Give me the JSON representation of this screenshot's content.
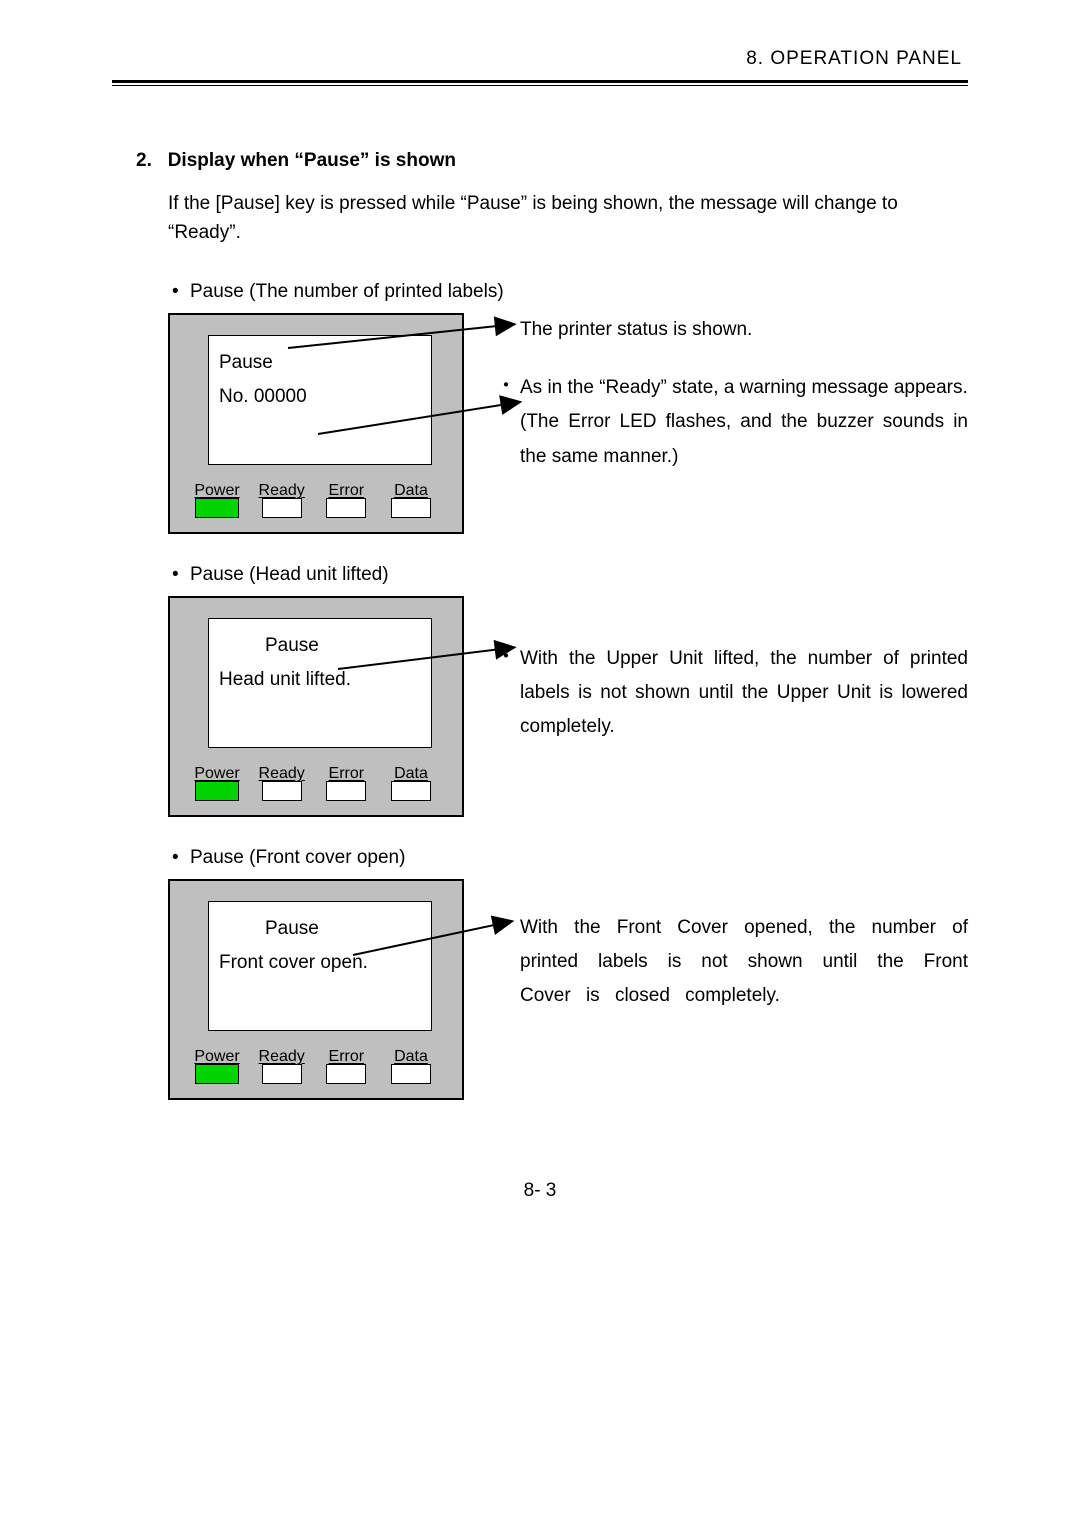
{
  "header": {
    "chapter": "8.  OPERATION  PANEL"
  },
  "section": {
    "num": "2.",
    "title": "Display when “Pause” is shown",
    "lead": "If the [Pause] key is pressed while “Pause” is being shown, the message will change to “Ready”."
  },
  "leds": {
    "power": "Power",
    "ready": "Ready",
    "error": "Error",
    "data": "Data"
  },
  "fig1": {
    "bullet": "Pause (The number of printed labels)",
    "lcd_l1": "Pause",
    "lcd_l2": "No. 00000",
    "note1": "The printer status is shown.",
    "note2a": "As  in  the  “Ready”  state,  a  warning message appears.",
    "note2b": "(The Error LED flashes, and the buzzer sounds in the same manner.)"
  },
  "fig2": {
    "bullet": "Pause (Head unit lifted)",
    "lcd_l1": "Pause",
    "lcd_l2": "Head unit lifted.",
    "note": "With  the  Upper  Unit  lifted,  the  number  of printed labels is not shown until the Upper Unit is lowered completely."
  },
  "fig3": {
    "bullet": "Pause (Front cover open)",
    "lcd_l1": "Pause",
    "lcd_l2": "Front cover open.",
    "note": "With  the  Front  Cover  opened,  the number of printed labels is not shown until  the  Front  Cover  is  closed completely."
  },
  "footer": {
    "page": "8-  3"
  }
}
